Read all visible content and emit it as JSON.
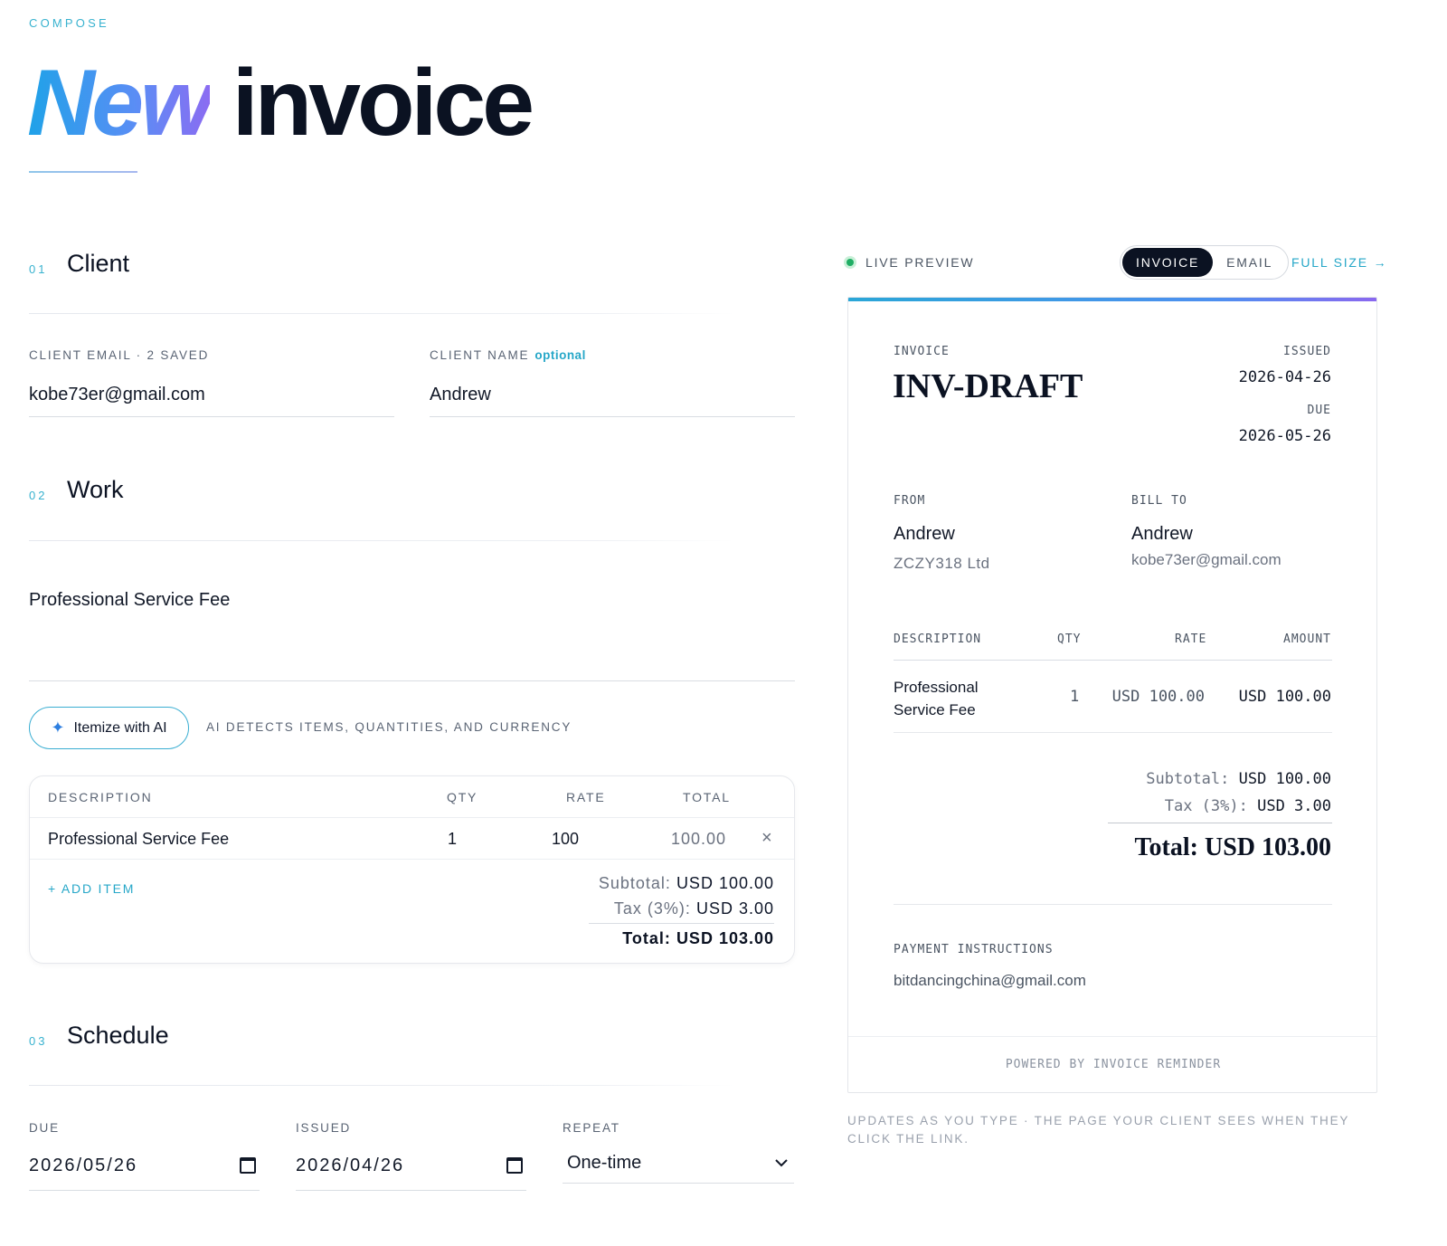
{
  "header": {
    "eyebrow": "COMPOSE",
    "title_accent": "New",
    "title_rest": "invoice"
  },
  "sections": {
    "client": {
      "num": "01",
      "title": "Client"
    },
    "work": {
      "num": "02",
      "title": "Work"
    },
    "schedule": {
      "num": "03",
      "title": "Schedule"
    }
  },
  "client": {
    "email_label": "CLIENT EMAIL · 2 SAVED",
    "email_value": "kobe73er@gmail.com",
    "name_label": "CLIENT NAME",
    "name_optional": "optional",
    "name_value": "Andrew"
  },
  "work": {
    "description": "Professional Service Fee",
    "ai_button": "Itemize with AI",
    "ai_hint": "AI DETECTS ITEMS, QUANTITIES, AND CURRENCY",
    "table": {
      "headers": [
        "DESCRIPTION",
        "QTY",
        "RATE",
        "TOTAL"
      ],
      "rows": [
        {
          "description": "Professional Service Fee",
          "qty": "1",
          "rate": "100",
          "total": "100.00"
        }
      ],
      "add_item": "+ ADD ITEM",
      "subtotal_label": "Subtotal:",
      "subtotal_value": "USD 100.00",
      "tax_label": "Tax (3%):",
      "tax_value": "USD 3.00",
      "total_label": "Total:",
      "total_value": "USD 103.00"
    }
  },
  "schedule": {
    "due_label": "DUE",
    "due_value": "2026/05/26",
    "issued_label": "ISSUED",
    "issued_value": "2026/04/26",
    "repeat_label": "REPEAT",
    "repeat_value": "One-time"
  },
  "preview_bar": {
    "live_label": "LIVE PREVIEW",
    "tab_invoice": "INVOICE",
    "tab_email": "EMAIL",
    "full_size": "FULL SIZE →",
    "live_color": "#22c55e"
  },
  "preview": {
    "invoice_label": "INVOICE",
    "invoice_number": "INV-DRAFT",
    "issued_label": "ISSUED",
    "issued_value": "2026-04-26",
    "due_label": "DUE",
    "due_value": "2026-05-26",
    "from_label": "FROM",
    "from_name": "Andrew",
    "from_company": "ZCZY318 Ltd",
    "bill_label": "BILL TO",
    "bill_name": "Andrew",
    "bill_email": "kobe73er@gmail.com",
    "headers": [
      "DESCRIPTION",
      "QTY",
      "RATE",
      "AMOUNT"
    ],
    "row": {
      "desc_line1": "Professional",
      "desc_line2": "Service Fee",
      "qty": "1",
      "rate": "USD 100.00",
      "amount": "USD 100.00"
    },
    "subtotal_label": "Subtotal:",
    "subtotal_value": "USD 100.00",
    "tax_label": "Tax (3%):",
    "tax_value": "USD 3.00",
    "total": "Total: USD 103.00",
    "payment_label": "PAYMENT INSTRUCTIONS",
    "payment_value": "bitdancingchina@gmail.com",
    "footer": "POWERED BY INVOICE REMINDER"
  },
  "preview_note": "UPDATES AS YOU TYPE · THE PAGE YOUR CLIENT SEES WHEN THEY CLICK THE LINK."
}
